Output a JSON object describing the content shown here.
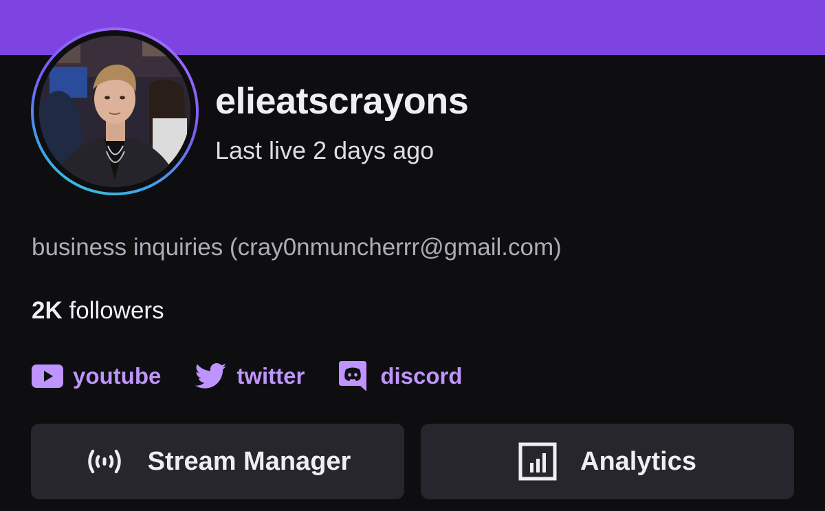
{
  "profile": {
    "username": "elieatscrayons",
    "last_live": "Last live 2 days ago",
    "bio": "business inquiries (cray0nmuncherrr@gmail.com)",
    "followers_count": "2K",
    "followers_label": " followers"
  },
  "socials": [
    {
      "label": "youtube",
      "icon": "youtube-icon"
    },
    {
      "label": "twitter",
      "icon": "twitter-icon"
    },
    {
      "label": "discord",
      "icon": "discord-icon"
    }
  ],
  "actions": {
    "stream_manager": {
      "label": "Stream Manager",
      "icon": "broadcast-icon"
    },
    "analytics": {
      "label": "Analytics",
      "icon": "bar-chart-icon"
    }
  },
  "colors": {
    "banner": "#7e44e2",
    "background": "#0e0e10",
    "link": "#bf94ff",
    "button": "#26262c"
  }
}
